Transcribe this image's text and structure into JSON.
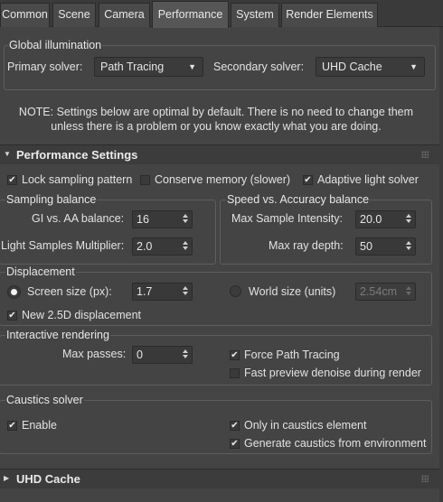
{
  "tabs": [
    "Common",
    "Scene",
    "Camera",
    "Performance",
    "System",
    "Render Elements"
  ],
  "active_tab": "Performance",
  "global_illumination": {
    "title": "Global illumination",
    "primary_label": "Primary solver:",
    "primary_value": "Path Tracing",
    "secondary_label": "Secondary solver:",
    "secondary_value": "UHD Cache"
  },
  "note": {
    "line1": "NOTE: Settings below are optimal by default. There is no need to change them",
    "line2": "unless there is a problem or you know exactly what you are doing."
  },
  "performance_settings": {
    "title": "Performance Settings",
    "lock_sampling": {
      "label": "Lock sampling pattern",
      "checked": true
    },
    "conserve_memory": {
      "label": "Conserve memory (slower)",
      "checked": false
    },
    "adaptive_light": {
      "label": "Adaptive light solver",
      "checked": true
    }
  },
  "sampling_balance": {
    "title": "Sampling balance",
    "gi_aa_label": "GI vs. AA balance:",
    "gi_aa_value": "16",
    "light_samples_label": "Light Samples Multiplier:",
    "light_samples_value": "2.0"
  },
  "speed_accuracy": {
    "title": "Speed vs. Accuracy balance",
    "max_sample_label": "Max Sample Intensity:",
    "max_sample_value": "20.0",
    "max_ray_label": "Max ray depth:",
    "max_ray_value": "50"
  },
  "displacement": {
    "title": "Displacement",
    "screen_size_label": "Screen size (px):",
    "screen_size_value": "1.7",
    "world_size_label": "World size (units)",
    "world_size_value": "2.54cm",
    "new_25d": {
      "label": "New 2.5D displacement",
      "checked": true
    }
  },
  "interactive": {
    "title": "Interactive rendering",
    "max_passes_label": "Max passes:",
    "max_passes_value": "0",
    "force_path": {
      "label": "Force Path Tracing",
      "checked": true
    },
    "fast_preview": {
      "label": "Fast preview denoise during render",
      "checked": false
    }
  },
  "caustics": {
    "title": "Caustics solver",
    "enable": {
      "label": "Enable",
      "checked": true
    },
    "only_element": {
      "label": "Only in caustics element",
      "checked": true
    },
    "from_env": {
      "label": "Generate caustics from environment",
      "checked": true
    }
  },
  "uhd_cache": {
    "title": "UHD Cache"
  },
  "glyphs": {
    "check": "✔",
    "dropdown": "▼",
    "expanded": "▼",
    "collapsed": "▶"
  }
}
